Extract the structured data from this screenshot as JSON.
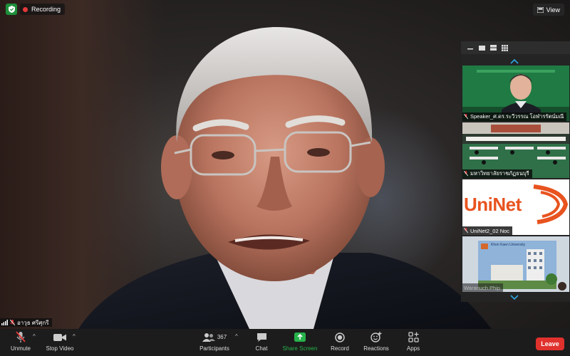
{
  "window": {
    "recording_label": "Recording",
    "view_label": "View"
  },
  "main_video": {
    "participant_name": "อาวุธ ศรีศุกรี"
  },
  "gallery": {
    "tiles": [
      {
        "name": "Speaker_ศ.ดร.ระวีวรรณ  โอฬารรัตน์มณี",
        "muted": true
      },
      {
        "name": "มหาวิทยาลัยราชภัฏธนบุรี",
        "muted": true
      },
      {
        "name": "UniNet2_02 Noc",
        "muted": true,
        "logo_text": "UniNet"
      },
      {
        "name": "Waranuch Phip",
        "muted": true,
        "banner_text": "Khon Kaen University"
      }
    ]
  },
  "toolbar": {
    "unmute_label": "Unmute",
    "stop_video_label": "Stop Video",
    "participants_label": "Participants",
    "participants_count": "367",
    "chat_label": "Chat",
    "share_screen_label": "Share Screen",
    "record_label": "Record",
    "reactions_label": "Reactions",
    "apps_label": "Apps",
    "leave_label": "Leave"
  },
  "colors": {
    "share_green": "#27b24a",
    "leave_red": "#e0312d",
    "recording_red": "#e3383a",
    "uninet_orange": "#e8531f"
  }
}
